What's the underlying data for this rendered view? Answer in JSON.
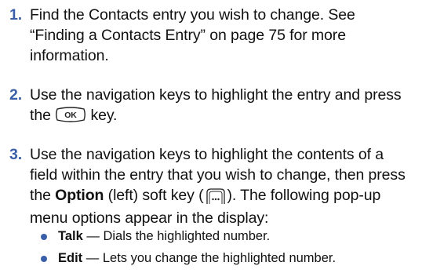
{
  "steps": [
    {
      "number": "1.",
      "line1": "Find the Contacts entry you wish to change. See",
      "line2": "“Finding a Contacts Entry” on page 75 for more",
      "line3": "information."
    },
    {
      "number": "2.",
      "line1": "Use the navigation keys to highlight the entry and press",
      "line2_pre": "the ",
      "line2_post": " key.",
      "key_label": "OK"
    },
    {
      "number": "3.",
      "line1": "Use the navigation keys to highlight the contents of a",
      "line2": "field within the entry that you wish to change, then press",
      "line3_pre": "the ",
      "option_label": "Option",
      "line3_mid": " (left) soft key (",
      "line3_post": "). The following pop-up",
      "line4": "menu options appear in the display:"
    }
  ],
  "bullets": [
    {
      "term": "Talk",
      "desc": " — Dials the highlighted number."
    },
    {
      "term": "Edit",
      "desc": " — Lets you change the highlighted number."
    }
  ],
  "icons": {
    "ok_key": "ok-key-icon",
    "left_soft_key": "left-soft-key-icon",
    "bullet": "bullet-dot-icon"
  },
  "colors": {
    "accent": "#3a5fa8",
    "text": "#111111"
  }
}
